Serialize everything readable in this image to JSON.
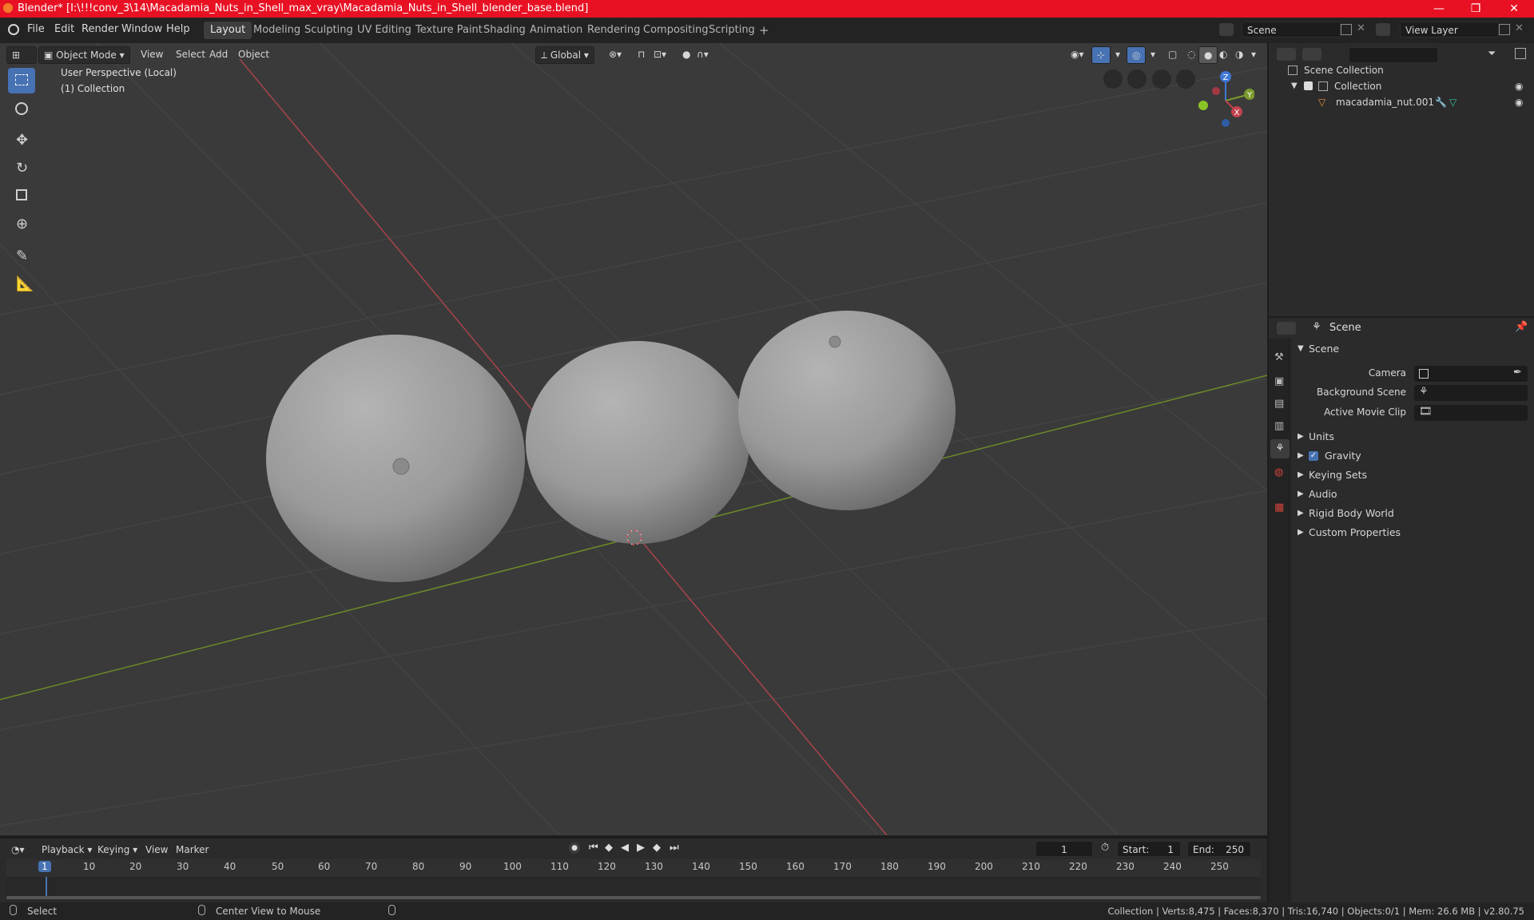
{
  "window": {
    "title": "Blender* [I:\\!!!conv_3\\14\\Macadamia_Nuts_in_Shell_max_vray\\Macadamia_Nuts_in_Shell_blender_base.blend]",
    "minimize": "—",
    "maximize": "❐",
    "close": "✕"
  },
  "menu": [
    "File",
    "Edit",
    "Render",
    "Window",
    "Help"
  ],
  "workspaces": [
    "Layout",
    "Modeling",
    "Sculpting",
    "UV Editing",
    "Texture Paint",
    "Shading",
    "Animation",
    "Rendering",
    "Compositing",
    "Scripting"
  ],
  "active_workspace": "Layout",
  "add_workspace": "+",
  "scene_field": "Scene",
  "view_layer_field": "View Layer",
  "viewport": {
    "mode": "Object Mode",
    "menus": [
      "View",
      "Select",
      "Add",
      "Object"
    ],
    "transform_orientation": "Global",
    "perspective_label": "User Perspective (Local)",
    "collection_label": "(1) Collection",
    "gizmo": {
      "z": "Z",
      "y": "Y",
      "x": "X"
    }
  },
  "outliner": {
    "search_placeholder": "",
    "root": "Scene Collection",
    "collection": "Collection",
    "object": "macadamia_nut.001"
  },
  "properties": {
    "header": "Scene",
    "section": "Scene",
    "camera_label": "Camera",
    "background_label": "Background Scene",
    "movieclip_label": "Active Movie Clip",
    "panels": [
      "Units",
      "Gravity",
      "Keying Sets",
      "Audio",
      "Rigid Body World",
      "Custom Properties"
    ],
    "gravity_checked": true
  },
  "timeline": {
    "menus": [
      "Playback",
      "Keying",
      "View",
      "Marker"
    ],
    "current_frame": "1",
    "start_label": "Start:",
    "start": "1",
    "end_label": "End:",
    "end": "250",
    "ticks": [
      "1",
      "10",
      "20",
      "30",
      "40",
      "50",
      "60",
      "70",
      "80",
      "90",
      "100",
      "110",
      "120",
      "130",
      "140",
      "150",
      "160",
      "170",
      "180",
      "190",
      "200",
      "210",
      "220",
      "230",
      "240",
      "250"
    ]
  },
  "statusbar": {
    "select": "Select",
    "center": "Center View to Mouse",
    "stats": "Collection | Verts:8,475 | Faces:8,370 | Tris:16,740 | Objects:0/1 | Mem: 26.6 MB | v2.80.75"
  },
  "colors": {
    "title_bar": "#e81123",
    "active_tool": "#4772b3",
    "x_axis": "#c0424d",
    "y_axis": "#7b9a2e",
    "z_axis": "#3f78d6"
  }
}
